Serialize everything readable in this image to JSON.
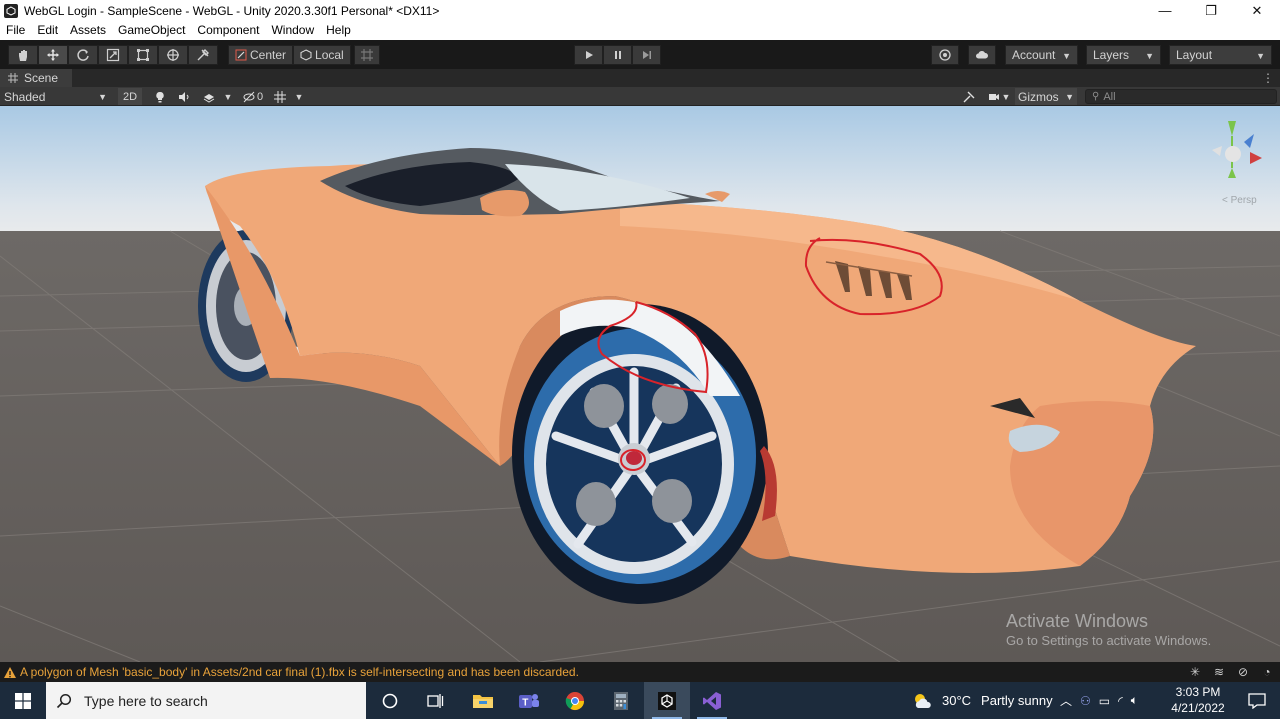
{
  "titlebar": {
    "title": "WebGL Login - SampleScene - WebGL - Unity 2020.3.30f1 Personal* <DX11>",
    "minimize": "—",
    "maximize": "❐",
    "close": "✕"
  },
  "menu": {
    "items": [
      "File",
      "Edit",
      "Assets",
      "GameObject",
      "Component",
      "Window",
      "Help"
    ]
  },
  "toolbar": {
    "tools": [
      "hand-tool",
      "move-tool",
      "rotate-tool",
      "scale-tool",
      "rect-tool",
      "transform-tool",
      "custom-tool"
    ],
    "active_tool": "move-tool",
    "pivot_label": "Center",
    "space_label": "Local",
    "account_label": "Account",
    "layers_label": "Layers",
    "layout_label": "Layout"
  },
  "scene": {
    "tab_label": "Scene",
    "shading_mode": "Shaded",
    "mode_2d": "2D",
    "hidden_count": "0",
    "gizmos_label": "Gizmos",
    "search_placeholder": "All",
    "persp_label": "< Persp"
  },
  "watermark": {
    "line1": "Activate Windows",
    "line2": "Go to Settings to activate Windows."
  },
  "statusbar": {
    "message": "A polygon of Mesh 'basic_body' in Assets/2nd car final (1).fbx is self-intersecting and has been discarded.",
    "warning_color": "#e8a23a"
  },
  "taskbar": {
    "search_placeholder": "Type here to search",
    "apps": [
      "task-view",
      "file-explorer",
      "teams",
      "chrome",
      "calculator",
      "unity",
      "visual-studio"
    ],
    "active_app": "unity",
    "weather_temp": "30°C",
    "weather_text": "Partly sunny",
    "time": "3:03 PM",
    "date": "4/21/2022"
  },
  "colors": {
    "car_body": "#f0a878",
    "annotation": "#d8232a",
    "sky_top": "#aacbe6",
    "ground": "#6a6562"
  }
}
